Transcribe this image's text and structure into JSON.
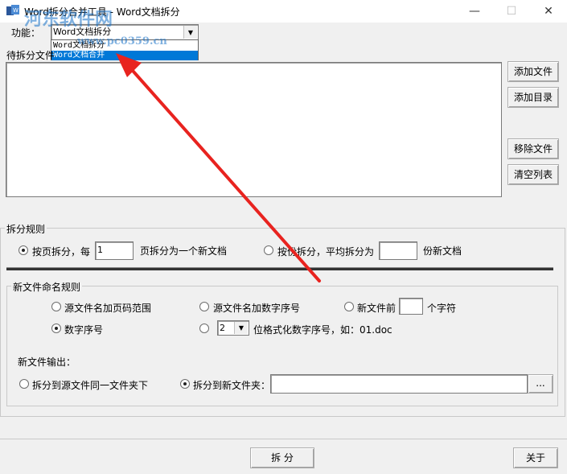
{
  "window": {
    "title": "Word拆分合并工具 - Word文档拆分",
    "minimize": "—",
    "maximize": "☐",
    "close": "✕"
  },
  "function_row": {
    "label": "功能：",
    "selected": "Word文档拆分",
    "options": [
      "Word文档拆分",
      "Word文档合并"
    ],
    "highlighted": "Word文档合并"
  },
  "watermark": {
    "line1": "河东软件网",
    "line2": "www.pc0359.cn"
  },
  "file_list": {
    "label": "待拆分文件",
    "add_file": "添加文件",
    "add_dir": "添加目录",
    "remove_file": "移除文件",
    "clear_list": "清空列表"
  },
  "split_rules": {
    "title": "拆分规则",
    "by_page_prefix": "按页拆分，每",
    "pages_value": "1",
    "by_page_suffix": "页拆分为一个新文档",
    "by_copies_prefix": "按份拆分，平均拆分为",
    "copies_value": "",
    "by_copies_suffix": "份新文档",
    "selected": "by_page"
  },
  "naming": {
    "title": "新文件命名规则",
    "opt_page_range": "源文件名加页码范围",
    "opt_seq_number": "源文件名加数字序号",
    "opt_prefix_label": "新文件前",
    "prefix_value": "",
    "opt_prefix_suffix": "个字符",
    "opt_number": "数字序号",
    "digits_value": "2",
    "digits_suffix": "位格式化数字序号，如：01.doc",
    "selected": "数字序号"
  },
  "output": {
    "label": "新文件输出：",
    "same_folder": "拆分到源文件同一文件夹下",
    "new_folder": "拆分到新文件夹：",
    "folder_value": "",
    "browse": "...",
    "selected": "new_folder"
  },
  "footer": {
    "split_button": "拆 分",
    "about_button": "关于"
  },
  "colors": {
    "highlight": "#0078d7",
    "arrow": "#e8231f",
    "watermark": "#1a73c8"
  }
}
